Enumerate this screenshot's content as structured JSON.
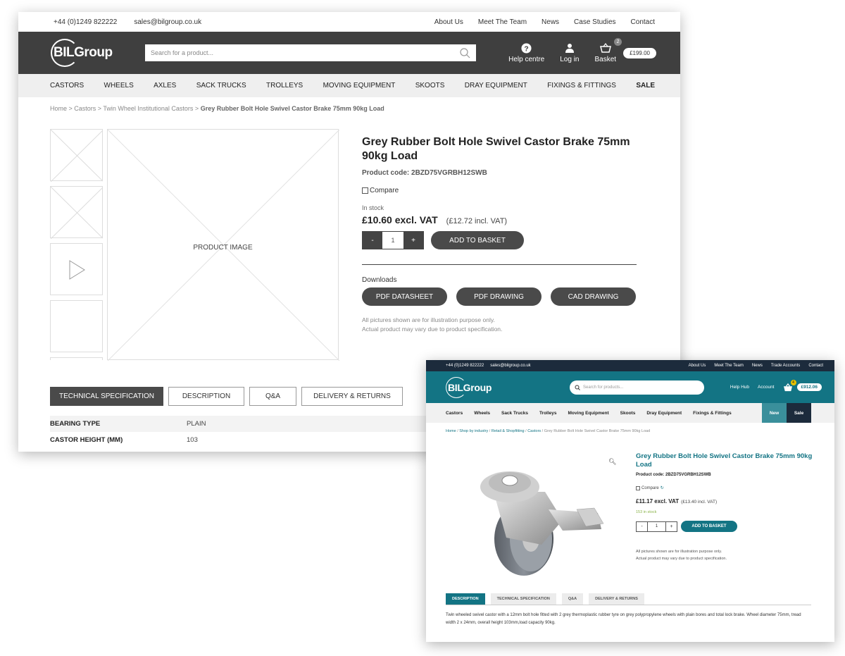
{
  "wireframe": {
    "topbar": {
      "phone": "+44 (0)1249 822222",
      "email": "sales@bilgroup.co.uk",
      "links": [
        "About Us",
        "Meet The Team",
        "News",
        "Case Studies",
        "Contact"
      ]
    },
    "header": {
      "logo": "BILGroup",
      "search_placeholder": "Search for a product...",
      "help": "Help centre",
      "login": "Log in",
      "basket": "Basket",
      "basket_count": "2",
      "basket_total": "£199.00"
    },
    "nav": [
      "CASTORS",
      "WHEELS",
      "AXLES",
      "SACK TRUCKS",
      "TROLLEYS",
      "MOVING EQUIPMENT",
      "SKOOTS",
      "DRAY EQUIPMENT",
      "FIXINGS & FITTINGS"
    ],
    "nav_sale": "SALE",
    "breadcrumb": {
      "trail": "Home > Castors > Twin Wheel Institutional Castors > ",
      "current": "Grey Rubber Bolt Hole Swivel Castor Brake 75mm 90kg Load"
    },
    "product": {
      "image_label": "PRODUCT IMAGE",
      "title": "Grey Rubber Bolt Hole Swivel Castor Brake 75mm 90kg Load",
      "code": "Product code: 2BZD75VGRBH12SWB",
      "compare": "Compare",
      "stock": "In stock",
      "price_ex": "£10.60 excl. VAT",
      "price_inc": "(£12.72 incl. VAT)",
      "qty_minus": "-",
      "qty": "1",
      "qty_plus": "+",
      "add": "ADD TO BASKET",
      "downloads_heading": "Downloads",
      "downloads": [
        "PDF DATASHEET",
        "PDF DRAWING",
        "CAD DRAWING"
      ],
      "note1": "All pictures shown are for illustration purpose only.",
      "note2": "Actual product may vary due to product specification."
    },
    "tabs": [
      "TECHNICAL SPECIFICATION",
      "DESCRIPTION",
      "Q&A",
      "DELIVERY & RETURNS"
    ],
    "spec": [
      {
        "key": "BEARING TYPE",
        "value": "PLAIN"
      },
      {
        "key": "CASTOR HEIGHT (MM)",
        "value": "103"
      }
    ]
  },
  "final": {
    "topbar": {
      "phone": "+44 (0)1249 822222",
      "email": "sales@bilgroup.co.uk",
      "links": [
        "About Us",
        "Meet The Team",
        "News",
        "Trade Accounts",
        "Contact"
      ]
    },
    "header": {
      "logo": "BILGroup",
      "search_placeholder": "Search for products...",
      "help": "Help Hub",
      "account": "Account",
      "basket_count": "4",
      "basket_total": "£912.06"
    },
    "nav": [
      "Castors",
      "Wheels",
      "Sack Trucks",
      "Trolleys",
      "Moving Equipment",
      "Skoots",
      "Dray Equipment",
      "Fixings & Fittings"
    ],
    "nav_new": "New",
    "nav_sale": "Sale",
    "breadcrumb": {
      "home": "Home",
      "sep": " / ",
      "c1": "Shop by industry",
      "c2": "Retail & Shopfitting",
      "c3": "Castors",
      "current": "Grey Rubber Bolt Hole Swivel Castor Brake 75mm 90kg Load"
    },
    "product": {
      "title": "Grey Rubber Bolt Hole Swivel Castor Brake 75mm 90kg Load",
      "code": "Product code: 2BZD75VGRBH12SWB",
      "compare": "Compare",
      "price_ex": "£11.17 excl. VAT",
      "price_inc": "(£13.40 incl. VAT)",
      "stock": "153 in stock",
      "qty_minus": "-",
      "qty": "1",
      "qty_plus": "+",
      "add": "ADD TO BASKET",
      "note1": "All pictures shown are for illustration purpose only.",
      "note2": "Actual product may vary due to product specification."
    },
    "tabs": [
      "DESCRIPTION",
      "TECHNICAL SPECIFICATION",
      "Q&A",
      "DELIVERY & RETURNS"
    ],
    "description": "Twin wheeled swivel castor with a 12mm bolt hole fitted with 2 grey thermoplastic rubber tyre on grey polypropylene wheels with plain bores and total lock brake. Wheel diameter 75mm, tread width 2 x 24mm, overall height 103mm,load capacity 90kg."
  }
}
